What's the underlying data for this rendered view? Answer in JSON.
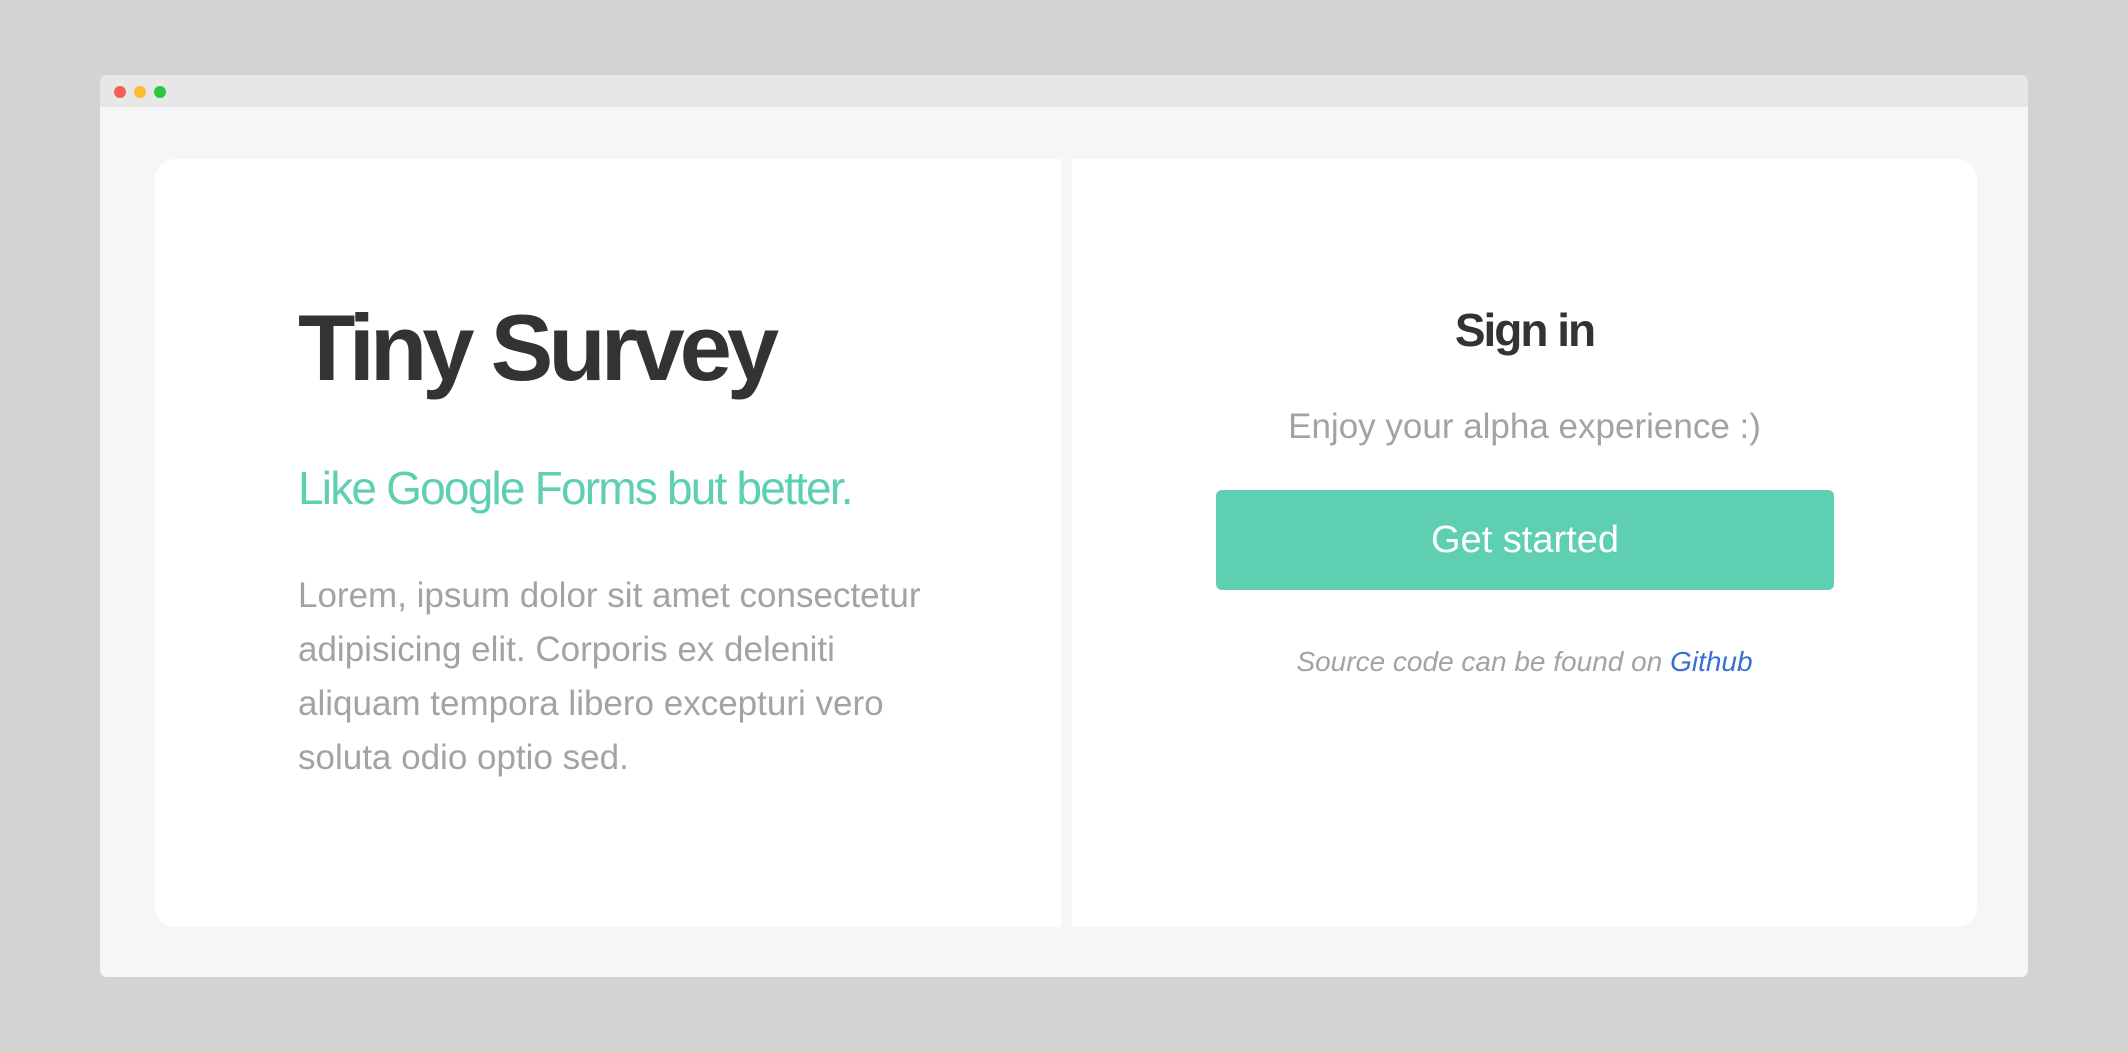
{
  "window": {
    "controls": [
      "close",
      "minimize",
      "maximize"
    ]
  },
  "left": {
    "title": "Tiny Survey",
    "tagline": "Like Google Forms but better.",
    "description": "Lorem, ipsum dolor sit amet consectetur adipisicing elit. Corporis ex deleniti aliquam tempora libero excepturi vero soluta odio optio sed."
  },
  "signin": {
    "title": "Sign in",
    "subtitle": "Enjoy your alpha experience :)",
    "button_label": "Get started",
    "source_prefix": "Source code can be found on ",
    "source_link_label": "Github"
  },
  "colors": {
    "page_background": "#d3d3d3",
    "window_background": "#f6f6f6",
    "titlebar": "#e7e7e7",
    "panel": "#ffffff",
    "dot_red": "#f65e56",
    "dot_yellow": "#fbbd2e",
    "dot_green": "#2bc840",
    "heading": "#333333",
    "accent": "#5ecfb1",
    "muted_text": "#a3a3a3",
    "link": "#3a6fd1",
    "button_text": "#ffffff"
  }
}
